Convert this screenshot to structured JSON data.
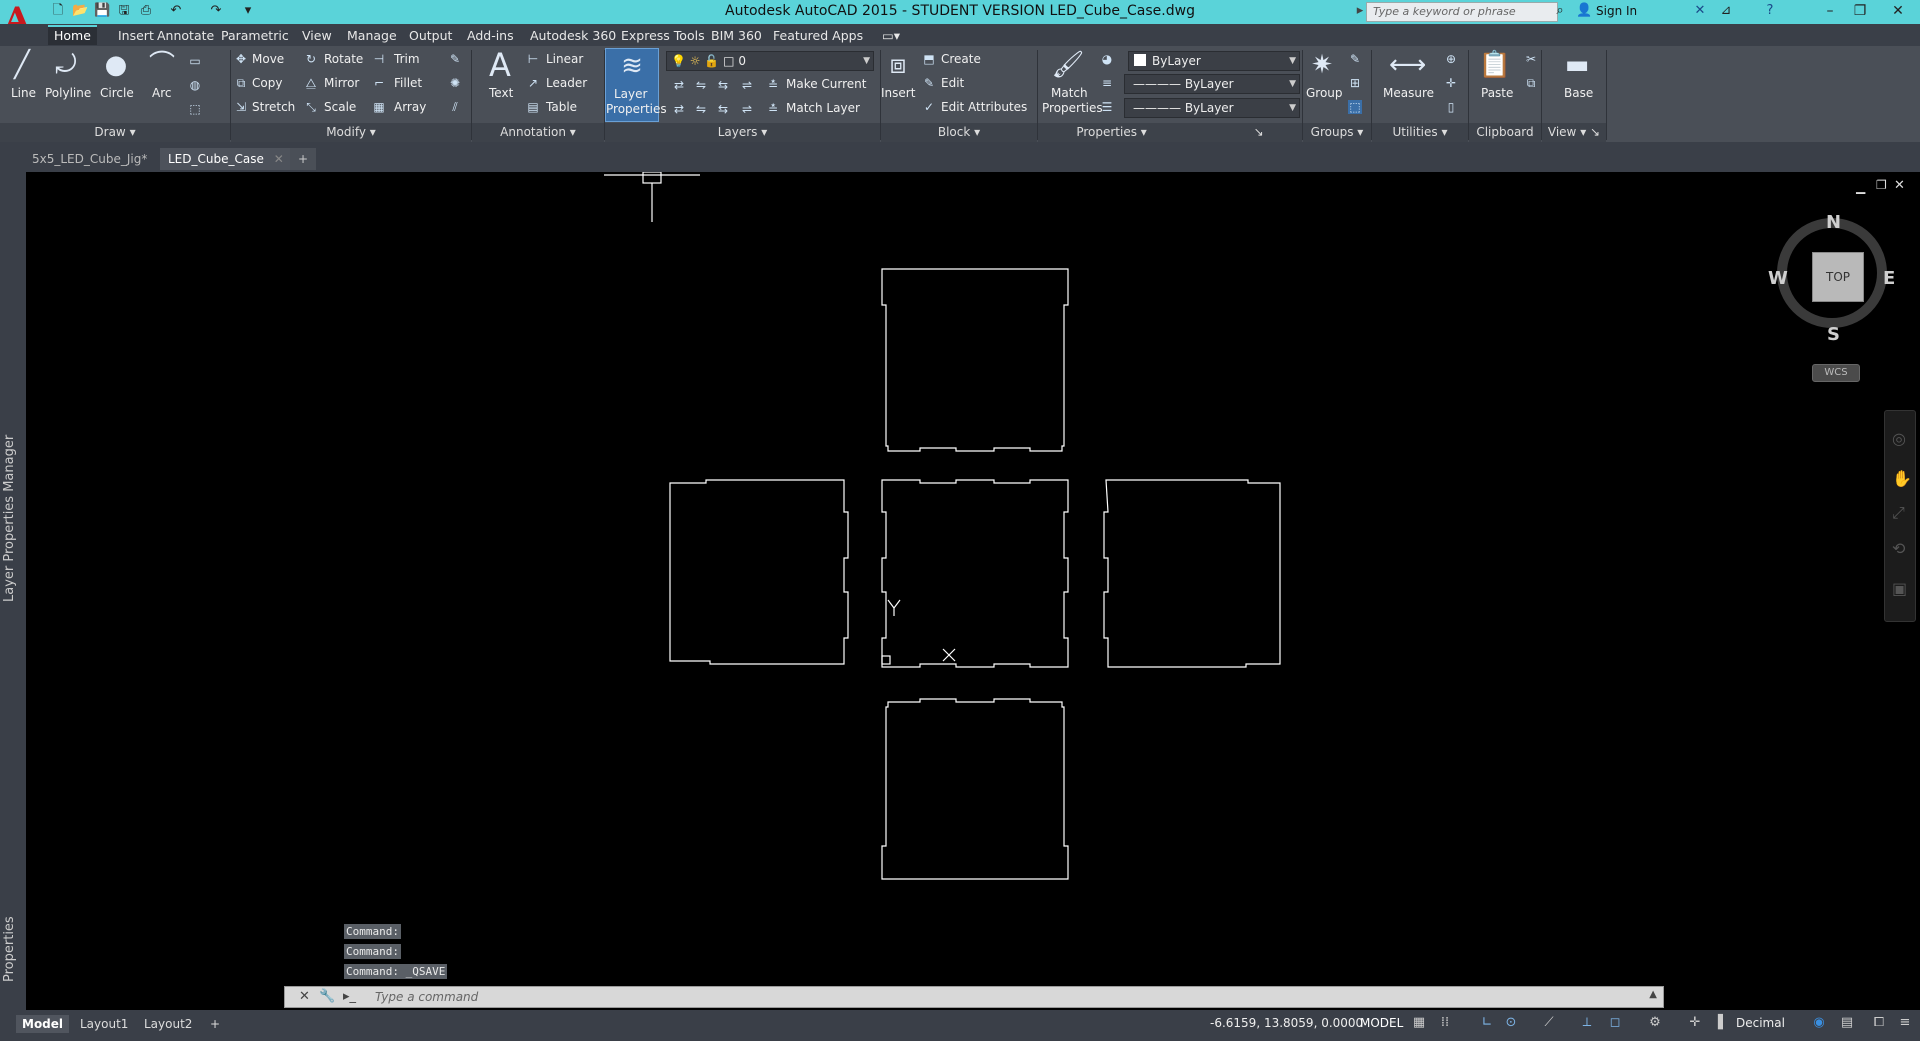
{
  "title": "Autodesk AutoCAD 2015 - STUDENT VERSION    LED_Cube_Case.dwg",
  "search": {
    "placeholder": "Type a keyword or phrase"
  },
  "signin": "Sign In",
  "ribbon_tabs": [
    "Home",
    "Insert",
    "Annotate",
    "Parametric",
    "View",
    "Manage",
    "Output",
    "Add-ins",
    "Autodesk 360",
    "Express Tools",
    "BIM 360",
    "Featured Apps"
  ],
  "draw": {
    "line": "Line",
    "polyline": "Polyline",
    "circle": "Circle",
    "arc": "Arc",
    "panel": "Draw"
  },
  "modify": {
    "move": "Move",
    "rotate": "Rotate",
    "trim": "Trim",
    "copy": "Copy",
    "mirror": "Mirror",
    "fillet": "Fillet",
    "stretch": "Stretch",
    "scale": "Scale",
    "array": "Array",
    "panel": "Modify"
  },
  "annotation": {
    "text": "Text",
    "linear": "Linear",
    "leader": "Leader",
    "table": "Table",
    "panel": "Annotation"
  },
  "layers": {
    "layer_props_1": "Layer",
    "layer_props_2": "Properties",
    "current_layer": "0",
    "make_current": "Make Current",
    "match_layer": "Match Layer",
    "panel": "Layers"
  },
  "block": {
    "insert": "Insert",
    "create": "Create",
    "edit": "Edit",
    "edit_attributes": "Edit Attributes",
    "panel": "Block"
  },
  "properties": {
    "match_1": "Match",
    "match_2": "Properties",
    "color": "ByLayer",
    "linetype": "ByLayer",
    "lineweight": "ByLayer",
    "panel": "Properties"
  },
  "groups": {
    "group": "Group",
    "panel": "Groups"
  },
  "utilities": {
    "measure": "Measure",
    "panel": "Utilities"
  },
  "clipboard": {
    "paste": "Paste",
    "panel": "Clipboard"
  },
  "view": {
    "base": "Base",
    "panel": "View"
  },
  "doc_tabs": {
    "tab1": "5x5_LED_Cube_Jig*",
    "tab2": "LED_Cube_Case"
  },
  "side_panels": {
    "layer_manager": "Layer Properties Manager",
    "properties": "Properties"
  },
  "viewcube": {
    "n": "N",
    "s": "S",
    "e": "E",
    "w": "W",
    "face": "TOP",
    "wcs": "WCS"
  },
  "command_history": [
    "Command:",
    "Command:",
    "Command: _QSAVE"
  ],
  "command_placeholder": "Type a command",
  "layout_tabs": [
    "Model",
    "Layout1",
    "Layout2"
  ],
  "status": {
    "coords": "-6.6159, 13.8059, 0.0000",
    "space": "MODEL",
    "units": "Decimal"
  }
}
